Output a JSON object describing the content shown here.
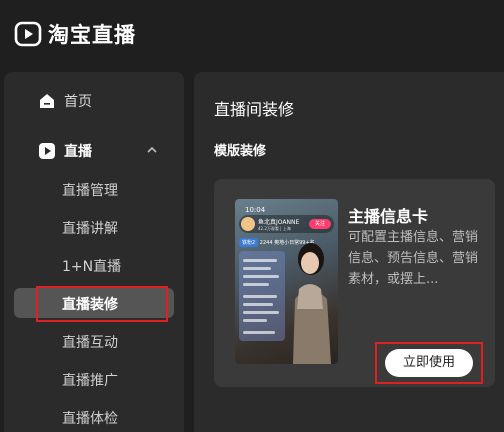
{
  "app": {
    "title": "淘宝直播"
  },
  "sidebar": {
    "home": {
      "label": "首页",
      "icon": "home-icon"
    },
    "live": {
      "label": "直播",
      "icon": "play-icon",
      "expanded": true
    },
    "subitems": [
      {
        "label": "直播管理"
      },
      {
        "label": "直播讲解"
      },
      {
        "label": "1+N直播"
      },
      {
        "label": "直播装修",
        "active": true
      },
      {
        "label": "直播互动"
      },
      {
        "label": "直播推广"
      },
      {
        "label": "直播体检"
      }
    ]
  },
  "main": {
    "title": "直播间装修",
    "section_title": "模版装修",
    "card": {
      "title": "主播信息卡",
      "description": "可配置主播信息、营销信息、预告信息、营销素材，或摆上...",
      "button_label": "立即使用",
      "preview": {
        "time": "10:04",
        "host_name": "鱼北真JOANNE",
        "host_sub": "42.2万观看 | 上海",
        "follow": "关注",
        "tag1": "铁粉2",
        "tag2": "2244",
        "tag3": "奥地小日常99+名"
      }
    }
  },
  "colors": {
    "background": "#1f1f1f",
    "panel": "#2b2b2b",
    "card": "#3a3a3a",
    "highlight": "#e02020",
    "active_item": "#555555"
  }
}
